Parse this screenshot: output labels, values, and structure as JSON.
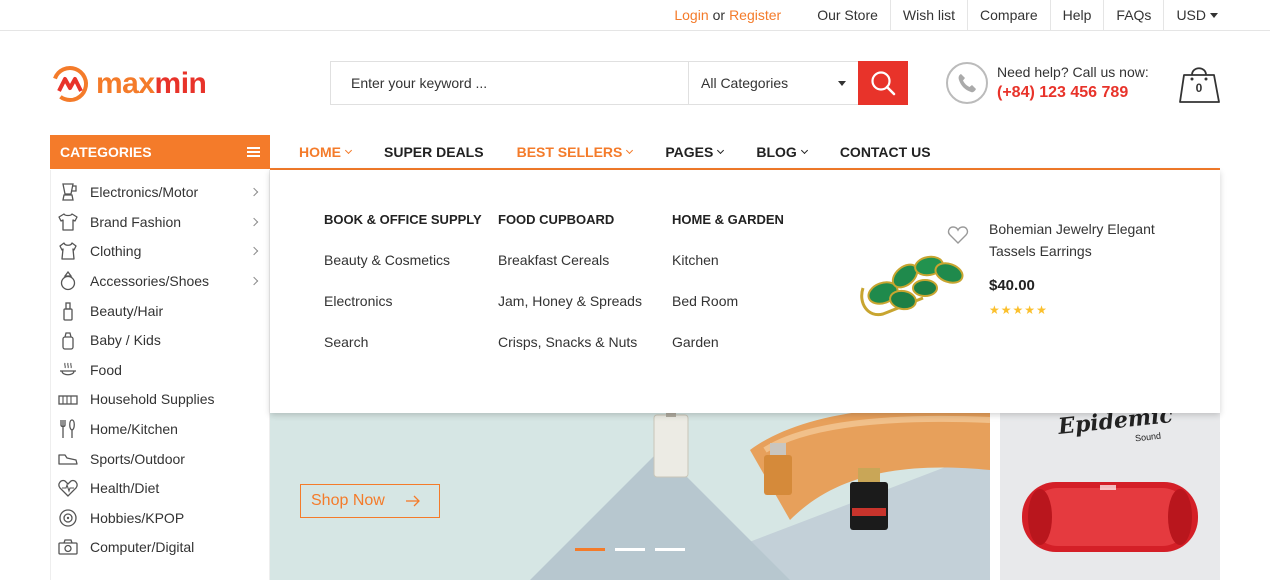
{
  "topbar": {
    "login": "Login",
    "or": "or",
    "register": "Register",
    "our_store": "Our Store",
    "wish_list": "Wish list",
    "compare": "Compare",
    "help": "Help",
    "faqs": "FAQs",
    "currency": "USD"
  },
  "logo": {
    "part1": "max",
    "part2": "min"
  },
  "search": {
    "placeholder": "Enter your keyword ...",
    "category": "All Categories"
  },
  "help": {
    "label": "Need help? Call us now:",
    "phone": "(+84) 123 456 789"
  },
  "cart": {
    "count": "0"
  },
  "categories_header": "CATEGORIES",
  "nav": {
    "home": "HOME",
    "super_deals": "SUPER DEALS",
    "best_sellers": "BEST SELLERS",
    "pages": "PAGES",
    "blog": "BLOG",
    "contact": "CONTACT US"
  },
  "sidebar": {
    "items": [
      {
        "label": "Electronics/Motor",
        "icon": "blender-icon",
        "arrow": true
      },
      {
        "label": "Brand Fashion",
        "icon": "tshirt-icon",
        "arrow": true
      },
      {
        "label": "Clothing",
        "icon": "baby-clothes-icon",
        "arrow": true
      },
      {
        "label": "Accessories/Shoes",
        "icon": "ring-icon",
        "arrow": true
      },
      {
        "label": "Beauty/Hair",
        "icon": "perfume-bottle-icon",
        "arrow": false
      },
      {
        "label": "Baby / Kids",
        "icon": "baby-bottle-icon",
        "arrow": false
      },
      {
        "label": "Food",
        "icon": "food-tray-icon",
        "arrow": false
      },
      {
        "label": "Household Supplies",
        "icon": "radiator-icon",
        "arrow": false
      },
      {
        "label": "Home/Kitchen",
        "icon": "cutlery-icon",
        "arrow": false
      },
      {
        "label": "Sports/Outdoor",
        "icon": "shoe-icon",
        "arrow": false
      },
      {
        "label": "Health/Diet",
        "icon": "heart-pulse-icon",
        "arrow": false
      },
      {
        "label": "Hobbies/KPOP",
        "icon": "disc-icon",
        "arrow": false
      },
      {
        "label": "Computer/Digital",
        "icon": "camera-icon",
        "arrow": false
      }
    ]
  },
  "mega": {
    "columns": [
      {
        "title": "BOOK & OFFICE SUPPLY",
        "links": [
          "Beauty & Cosmetics",
          "Electronics",
          "Search"
        ]
      },
      {
        "title": "FOOD CUPBOARD",
        "links": [
          "Breakfast Cereals",
          "Jam, Honey & Spreads",
          "Crisps, Snacks & Nuts"
        ]
      },
      {
        "title": "HOME & GARDEN",
        "links": [
          "Kitchen",
          "Bed Room",
          "Garden"
        ]
      }
    ],
    "product": {
      "name_line1": "Bohemian Jewelry Elegant",
      "name_line2": "Tassels Earrings",
      "price": "$40.00",
      "rating": 5
    }
  },
  "banner": {
    "cta": "Shop Now"
  },
  "side_banner": {
    "brand": "Epidemic",
    "brand_sub": "Sound"
  },
  "colors": {
    "accent": "#f47b2a",
    "red": "#e8332a"
  }
}
